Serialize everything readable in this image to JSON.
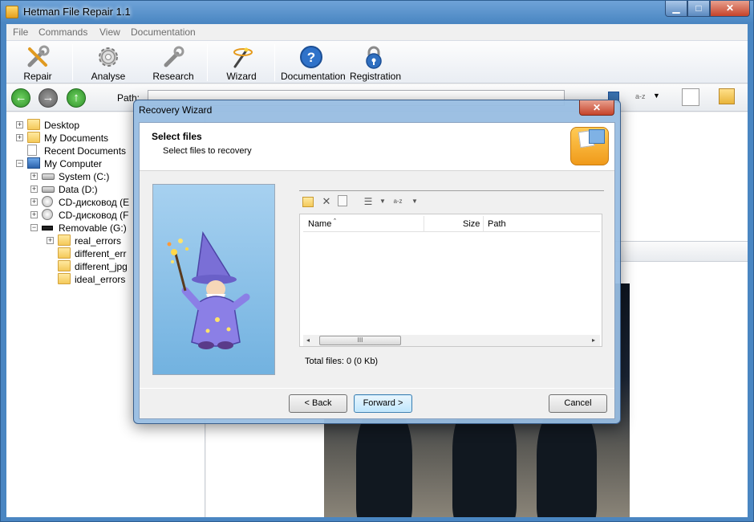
{
  "window": {
    "title": "Hetman File Repair 1.1"
  },
  "titlebar_buttons": {
    "minimize": "▁",
    "maximize": "□",
    "close": "✕"
  },
  "menu": [
    "File",
    "Commands",
    "View",
    "Documentation"
  ],
  "toolbar": {
    "repair": "Repair",
    "analyse": "Analyse",
    "research": "Research",
    "wizard": "Wizard",
    "documentation": "Documentation",
    "registration": "Registration"
  },
  "navbar": {
    "path_label": "Path:",
    "back": "←",
    "forward": "→",
    "up": "↑",
    "sort_icon": "a-z"
  },
  "tree": [
    {
      "label": "Desktop"
    },
    {
      "label": "My Documents"
    },
    {
      "label": "Recent Documents"
    },
    {
      "label": "My Computer"
    },
    {
      "label": "System (C:)"
    },
    {
      "label": "Data (D:)"
    },
    {
      "label": "CD-дисковод (E"
    },
    {
      "label": "CD-дисковод (F"
    },
    {
      "label": "Removable (G:)"
    },
    {
      "label": "real_errors"
    },
    {
      "label": "different_err"
    },
    {
      "label": "different_jpg"
    },
    {
      "label": "ideal_errors"
    }
  ],
  "dialog": {
    "title": "Recovery Wizard",
    "close": "✕",
    "heading": "Select files",
    "subheading": "Select files to recovery",
    "files_toolbar": {
      "sort_icon": "a-z"
    },
    "columns": {
      "name": "Name",
      "sort_mark": "ˆ",
      "size": "Size",
      "path": "Path"
    },
    "scroll": {
      "left": "◂",
      "thumb": "III",
      "right": "▸"
    },
    "total": "Total files: 0 (0 Kb)",
    "buttons": {
      "back": "< Back",
      "forward": "Forward >",
      "cancel": "Cancel"
    }
  },
  "colors": {
    "window_frame": "#4a86c2",
    "nav_back": "#3aa635",
    "nav_forward": "#7b7b7b",
    "nav_up": "#3aa635",
    "folder": "#f4c95a",
    "wizard_bg": "#72b2e0"
  }
}
